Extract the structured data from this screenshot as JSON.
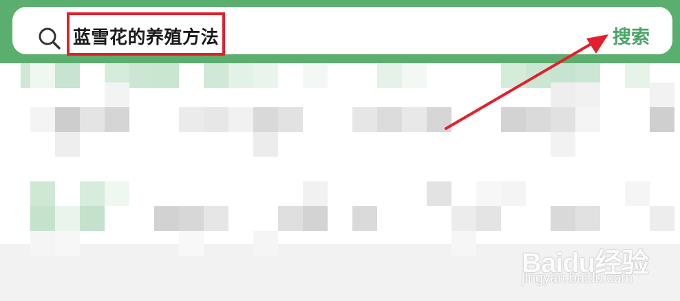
{
  "search": {
    "query": "蓝雪花的养殖方法",
    "button_label": "搜索"
  },
  "watermark": {
    "logo_text": "Baidu经验",
    "url_text": "jingyan.baidu.com"
  },
  "colors": {
    "header_green": "#5aaf6e",
    "button_green": "#4ba566",
    "highlight_red": "#e0202a",
    "arrow_red": "#e41e2a"
  }
}
